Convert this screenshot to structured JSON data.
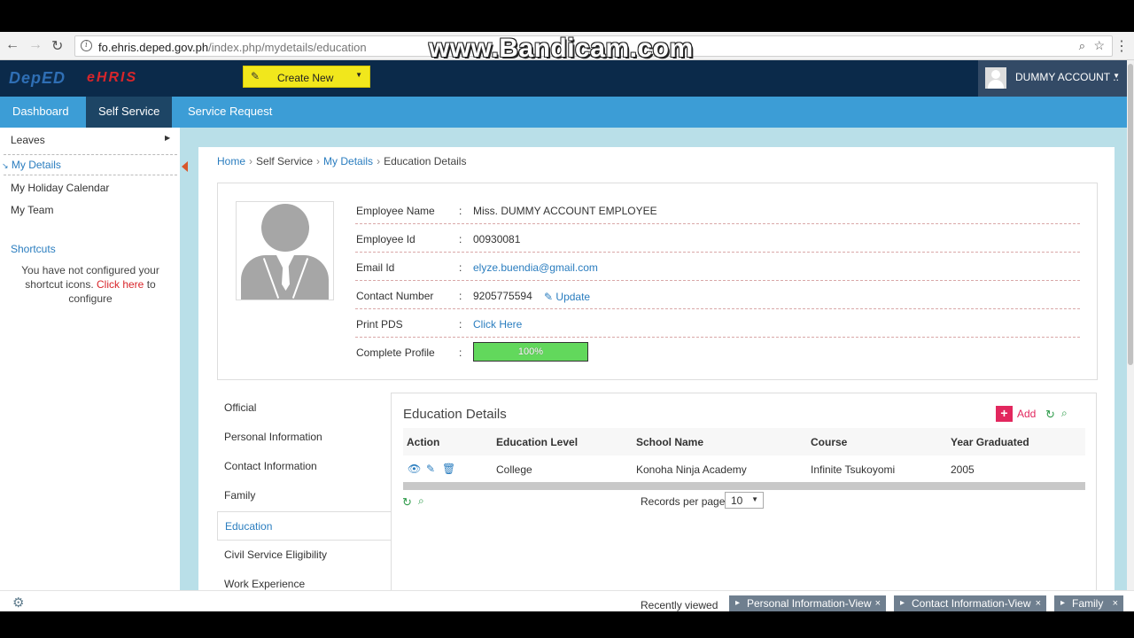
{
  "browser": {
    "url_host": "fo.ehris.deped.gov.ph",
    "url_path": "/index.php/mydetails/education",
    "watermark": "www.Bandicam.com"
  },
  "header": {
    "logo_part1": "DepED",
    "logo_part2": "eHRIS",
    "create_new_label": "Create New",
    "account_name": "DUMMY ACCOUNT .."
  },
  "nav": {
    "dashboard": "Dashboard",
    "self_service": "Self Service",
    "service_request": "Service Request"
  },
  "sidebar": {
    "leaves": "Leaves",
    "my_details": "My Details",
    "holiday_calendar": "My Holiday Calendar",
    "my_team": "My Team",
    "shortcuts_title": "Shortcuts",
    "shortcuts_text_1": "You have not configured your shortcut icons.",
    "shortcuts_link": "Click here",
    "shortcuts_text_2": "to configure"
  },
  "breadcrumb": {
    "home": "Home",
    "self_service": "Self Service",
    "my_details": "My Details",
    "current": "Education Details"
  },
  "profile": {
    "employee_name_label": "Employee Name",
    "employee_name": "Miss. DUMMY ACCOUNT EMPLOYEE",
    "employee_id_label": "Employee Id",
    "employee_id": "00930081",
    "email_label": "Email Id",
    "email": "elyze.buendia@gmail.com",
    "contact_label": "Contact Number",
    "contact": "9205775594",
    "update_label": "Update",
    "print_pds_label": "Print PDS",
    "print_pds_link": "Click Here",
    "complete_profile_label": "Complete Profile",
    "complete_profile_value": "100%",
    "colon": ":"
  },
  "tabs": [
    "Official",
    "Personal Information",
    "Contact Information",
    "Family",
    "Education",
    "Civil Service Eligibility",
    "Work Experience"
  ],
  "education": {
    "title": "Education Details",
    "add_label": "Add",
    "columns": [
      "Action",
      "Education Level",
      "School Name",
      "Course",
      "Year Graduated"
    ],
    "rows": [
      {
        "level": "College",
        "school": "Konoha Ninja Academy",
        "course": "Infinite Tsukoyomi",
        "year": "2005"
      }
    ],
    "records_per_page_label": "Records per page",
    "records_per_page": "10"
  },
  "footer": {
    "recently_viewed": "Recently viewed",
    "items": [
      "Personal Information-View",
      "Contact Information-View",
      "Family"
    ]
  },
  "colors": {
    "nav_blue": "#3c9dd6",
    "header_navy": "#0b2a4a",
    "accent_yellow": "#f1e71c",
    "link_blue": "#2a7dbf",
    "progress_green": "#62d85c",
    "add_pink": "#e2275e"
  }
}
